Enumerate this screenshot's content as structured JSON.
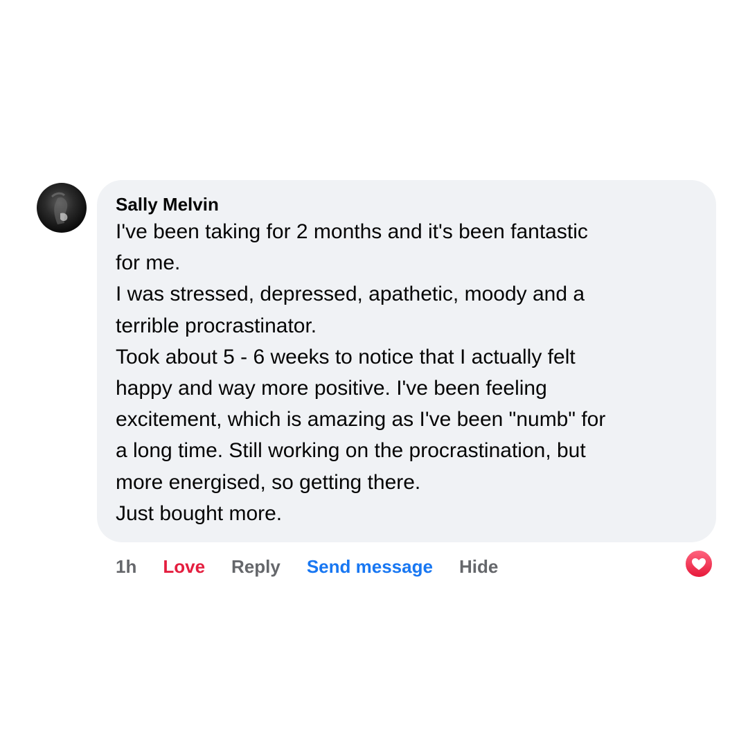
{
  "comment": {
    "author": "Sally Melvin",
    "lines": [
      "I've been taking for 2 months and it's been fantastic",
      "for me.",
      "I was stressed, depressed, apathetic, moody and a",
      "terrible procrastinator.",
      "Took about 5 - 6 weeks to notice that I actually felt",
      "happy and way more positive. I've been feeling",
      "excitement, which is amazing as I've been \"numb\" for",
      "a long time. Still working on the procrastination, but",
      "more energised, so getting there.",
      "Just bought more."
    ]
  },
  "actions": {
    "time": "1h",
    "love": "Love",
    "reply": "Reply",
    "send_message": "Send message",
    "hide": "Hide"
  },
  "reaction": {
    "icon": "love-reaction-icon",
    "color": "#f33e58"
  },
  "colors": {
    "bubble": "#f0f2f5",
    "love": "#e41e3f",
    "link": "#1877f2",
    "muted": "#65676b"
  }
}
